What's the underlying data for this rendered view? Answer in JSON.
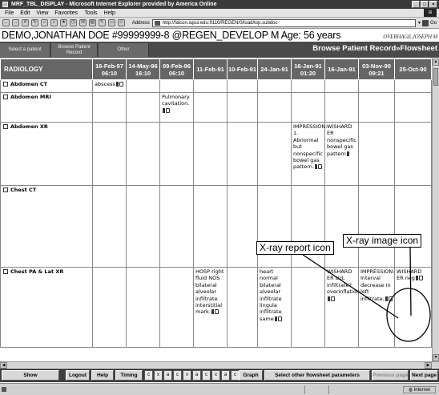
{
  "window": {
    "title": "MRF_TBL_DISPLAY - Microsoft Internet Explorer provided by America Online",
    "controls": [
      "_",
      "□",
      "×"
    ]
  },
  "menu": [
    "File",
    "Edit",
    "View",
    "Favorites",
    "Tools",
    "Help"
  ],
  "toolbar": {
    "address_label": "Address",
    "address_url": "http://falcon.iupui.edu:9110/REGEN/0/load/top.subdoc",
    "go_label": "Go",
    "icons": [
      "back-icon",
      "forward-icon",
      "stop-icon",
      "refresh-icon",
      "home-icon",
      "search-icon",
      "favorites-icon",
      "history-icon",
      "mail-icon",
      "print-icon",
      "edit-icon",
      "discuss-icon",
      "messenger-icon"
    ]
  },
  "patient": {
    "header": "DEMO,JONATHAN DOE  #99999999-8 @REGEN_DEVELOP  M  Age: 56 years",
    "user": "OVERHAGE,JOSEPH M"
  },
  "nav": {
    "tabs": [
      "Select a patient",
      "Browse Patient Record",
      "Other"
    ],
    "title": "Browse Patient Record»Flowsheet"
  },
  "grid": {
    "category": "RADIOLOGY",
    "columns": [
      {
        "date": "16-Feb-97",
        "time": "06:10"
      },
      {
        "date": "14-May-96",
        "time": "16:10"
      },
      {
        "date": "09-Feb-96",
        "time": "06:10"
      },
      {
        "date": "11-Feb-91",
        "time": ""
      },
      {
        "date": "10-Feb-91",
        "time": ""
      },
      {
        "date": "24-Jan-91",
        "time": ""
      },
      {
        "date": "16-Jan-91",
        "time": "01:20"
      },
      {
        "date": "16-Jan-91",
        "time": ""
      },
      {
        "date": "03-Nov-90",
        "time": "09:21"
      },
      {
        "date": "25-Oct-90",
        "time": ""
      }
    ],
    "rows": [
      {
        "label": "Abdomen CT",
        "cells": [
          {
            "text": "abscess",
            "rep": true,
            "img": true
          },
          null,
          null,
          null,
          null,
          null,
          null,
          null,
          null,
          null
        ]
      },
      {
        "label": "Abdomen MRI",
        "cells": [
          null,
          null,
          {
            "text": "Pulmonary cavitation.",
            "rep": true,
            "img": true
          },
          null,
          null,
          null,
          null,
          null,
          null,
          null
        ]
      },
      {
        "label": "Abdomen XR",
        "cells": [
          null,
          null,
          null,
          null,
          null,
          null,
          {
            "text": "IMPRESSION:\n1. Abnormal but nonspecific bowel gas pattern.",
            "rep": true,
            "img": true
          },
          {
            "text": "WISHARD ER nonspecific bowel gas pattern",
            "rep": true,
            "img": false
          },
          null,
          null
        ]
      },
      {
        "label": "Chest CT",
        "cells": [
          null,
          null,
          null,
          null,
          null,
          null,
          null,
          null,
          null,
          null
        ]
      },
      {
        "label": "Chest PA & Lat XR",
        "cells": [
          null,
          null,
          null,
          {
            "text": "HOSP right fluid NOS bilateral alveolar infiltrate interstitial mark.",
            "rep": true,
            "img": true
          },
          null,
          {
            "text": "heart normal bilateral alveolar infiltrate lingula infiltrate same",
            "rep": true,
            "img": true
          },
          null,
          {
            "text": "WISHARD ER LUL infiltrate? overinflation",
            "rep": true,
            "img": true
          },
          {
            "text": "IMPRESSION: Interval decrease in left infiltrate.",
            "rep": true,
            "img": true
          },
          {
            "text": "WISHARD ER neg",
            "rep": true,
            "img": true
          }
        ]
      }
    ]
  },
  "callouts": {
    "report": "X-ray report icon",
    "image": "X-ray image icon"
  },
  "bottom": {
    "buttons": [
      "Show",
      "Logout",
      "Help",
      "Timing",
      "Graph",
      "Select other flowsheet parameters",
      "Previous page",
      "Next page"
    ],
    "icon_letters": [
      "c",
      "x",
      "a",
      "c",
      "x",
      "a",
      "c",
      "x",
      "a",
      "c",
      "x"
    ]
  },
  "status": {
    "zone": "Internet"
  }
}
